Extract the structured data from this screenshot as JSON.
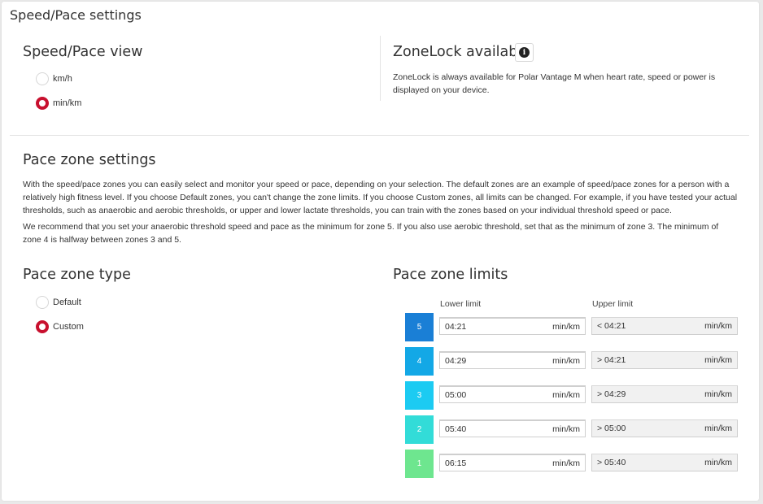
{
  "page_title": "Speed/Pace settings",
  "speed_view": {
    "heading": "Speed/Pace view",
    "options": [
      {
        "label": "km/h",
        "selected": false
      },
      {
        "label": "min/km",
        "selected": true
      }
    ]
  },
  "zonelock": {
    "heading": "ZoneLock available",
    "info_icon": "info-circle-icon",
    "description": "ZoneLock is always available for Polar Vantage M when heart rate, speed or power is displayed on your device."
  },
  "pace_zone_settings": {
    "heading": "Pace zone settings",
    "paragraph1": "With the speed/pace zones you can easily select and monitor your speed or pace, depending on your selection. The default zones are an example of speed/pace zones for a person with a relatively high fitness level. If you choose Default zones, you can't change the zone limits. If you choose Custom zones, all limits can be changed. For example, if you have tested your actual thresholds, such as anaerobic and aerobic thresholds, or upper and lower lactate thresholds, you can train with the zones based on your individual threshold speed or pace.",
    "paragraph2": "We recommend that you set your anaerobic threshold speed and pace as the minimum for zone 5. If you also use aerobic threshold, set that as the minimum of zone 3. The minimum of zone 4 is halfway between zones 3 and 5."
  },
  "pace_zone_type": {
    "heading": "Pace zone type",
    "options": [
      {
        "label": "Default",
        "selected": false
      },
      {
        "label": "Custom",
        "selected": true
      }
    ]
  },
  "pace_zone_limits": {
    "heading": "Pace zone limits",
    "lower_label": "Lower limit",
    "upper_label": "Upper limit",
    "unit": "min/km",
    "zones": [
      {
        "number": "5",
        "color": "#1a7fd6",
        "lower": "04:21",
        "upper": "< 04:21"
      },
      {
        "number": "4",
        "color": "#13a8e6",
        "lower": "04:29",
        "upper": "> 04:21"
      },
      {
        "number": "3",
        "color": "#1ccbf2",
        "lower": "05:00",
        "upper": "> 04:29"
      },
      {
        "number": "2",
        "color": "#32dcd8",
        "lower": "05:40",
        "upper": "> 05:00"
      },
      {
        "number": "1",
        "color": "#6ee68f",
        "lower": "06:15",
        "upper": "> 05:40"
      }
    ]
  },
  "colors": {
    "accent": "#c8102e"
  }
}
